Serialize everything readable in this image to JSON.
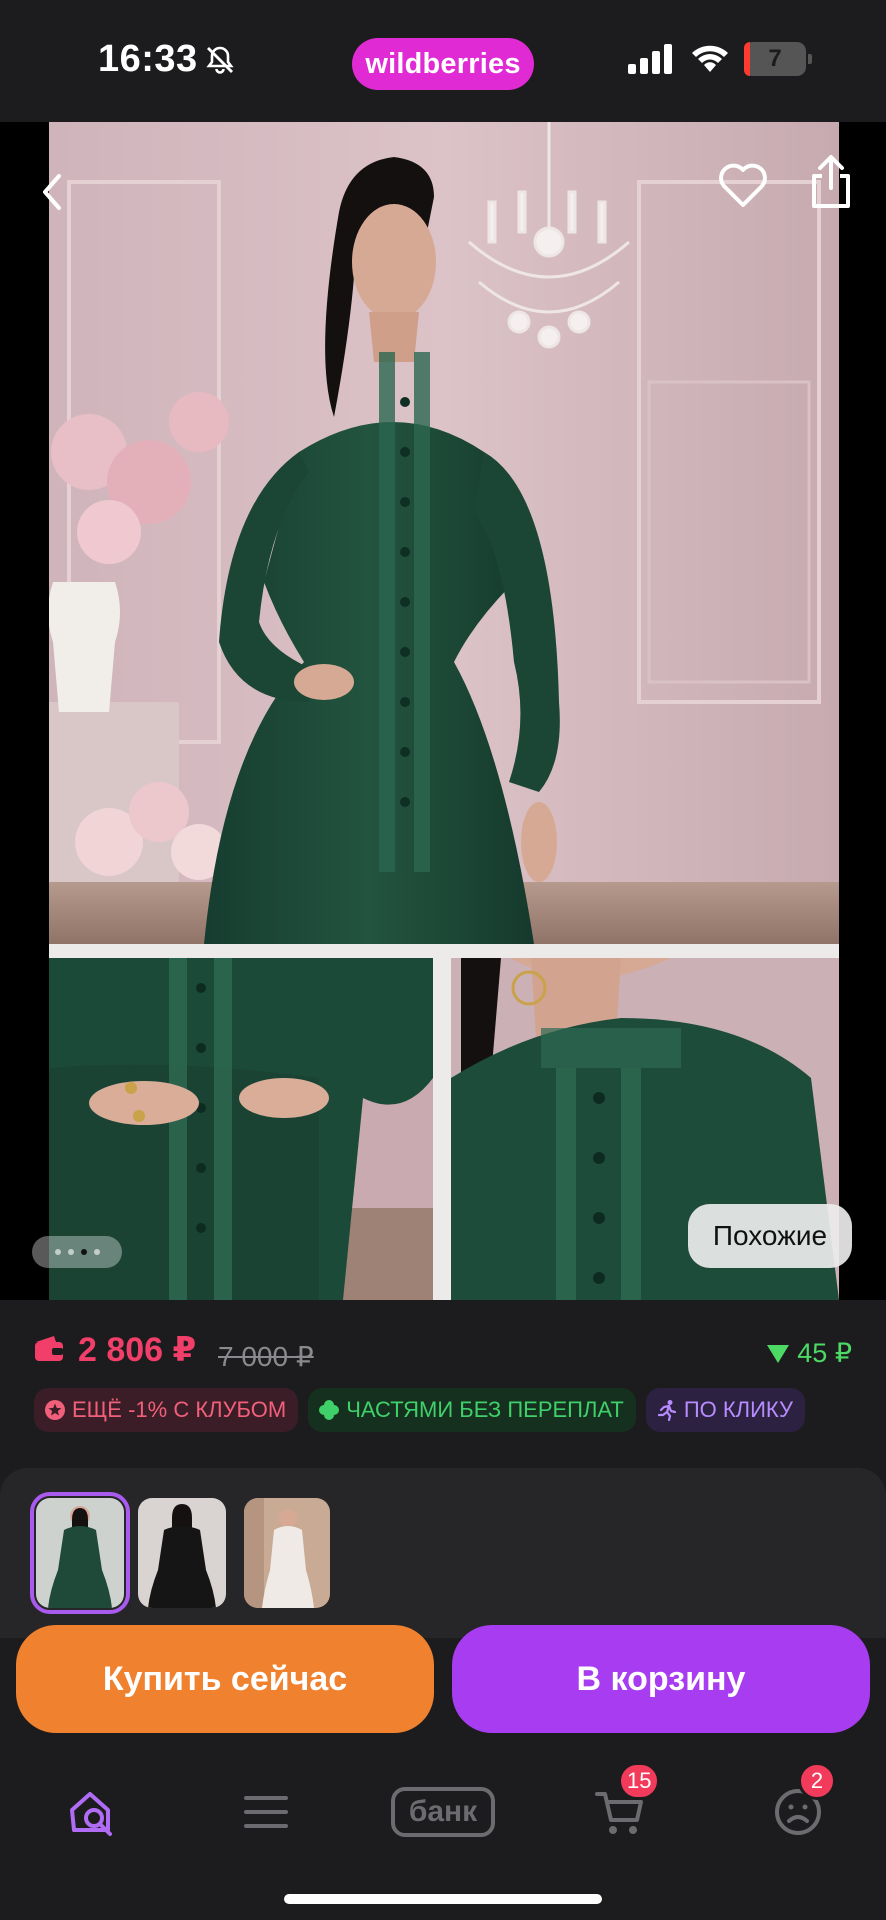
{
  "status_bar": {
    "time": "16:33",
    "brand": "wildberries",
    "battery": "7"
  },
  "gallery": {
    "dots": 4,
    "active_dot": 3,
    "similar_label": "Похожие"
  },
  "price": {
    "current": "2 806 ₽",
    "old": "7 000 ₽",
    "bonus": "45 ₽"
  },
  "tags": [
    {
      "label": "ЕЩЁ -1% С КЛУБОМ",
      "icon": "star-badge-icon"
    },
    {
      "label": "ЧАСТЯМИ БЕЗ ПЕРЕПЛАТ",
      "icon": "clover-icon"
    },
    {
      "label": "ПО КЛИКУ",
      "icon": "running-icon"
    }
  ],
  "variants": [
    {
      "color": "#1f4a3a",
      "selected": true
    },
    {
      "color": "#151515",
      "selected": false
    },
    {
      "color": "#efeae6",
      "selected": false
    }
  ],
  "actions": {
    "buy_now": "Купить сейчас",
    "add_to_cart": "В корзину"
  },
  "bottom_nav": {
    "bank_label": "банк",
    "cart_badge": "15",
    "profile_badge": "2"
  },
  "colors": {
    "brand": "#e02bd5",
    "price": "#f23f6a",
    "buy_now": "#f0812e",
    "add_to_cart": "#a73cf0",
    "bonus": "#4cd964"
  }
}
